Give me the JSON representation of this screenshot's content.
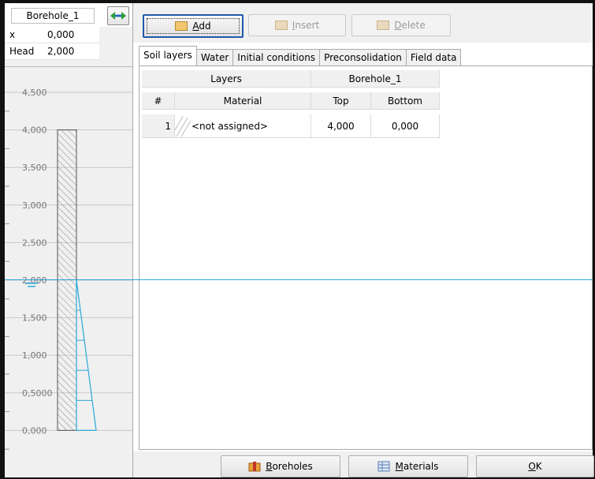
{
  "borehole": {
    "name": "Borehole_1",
    "props": [
      {
        "key": "x",
        "value": "0,000"
      },
      {
        "key": "Head",
        "value": "2,000"
      }
    ]
  },
  "depth_axis": {
    "labels": [
      "4,500",
      "4,000",
      "3,500",
      "3,000",
      "2,500",
      "2,000",
      "1,500",
      "1,000",
      "0,5000",
      "0,000"
    ],
    "head_level": 2.0,
    "layer_top": 4.0,
    "layer_bottom": 0.0
  },
  "toolbar": {
    "add_pre": "",
    "add_hot": "A",
    "add_post": "dd",
    "insert_pre": "",
    "insert_hot": "I",
    "insert_post": "nsert",
    "delete_pre": "",
    "delete_hot": "D",
    "delete_post": "elete"
  },
  "tabs": [
    "Soil layers",
    "Water",
    "Initial conditions",
    "Preconsolidation",
    "Field data"
  ],
  "table": {
    "group_layers": "Layers",
    "group_borehole": "Borehole_1",
    "col_num": "#",
    "col_material": "Material",
    "col_top": "Top",
    "col_bottom": "Bottom",
    "rows": [
      {
        "num": "1",
        "material": "<not assigned>",
        "top": "4,000",
        "bottom": "0,000"
      }
    ]
  },
  "bottom": {
    "boreholes_hot": "B",
    "boreholes_rest": "oreholes",
    "materials_hot": "M",
    "materials_rest": "aterials",
    "ok_hot": "O",
    "ok_rest": "K"
  },
  "colors": {
    "water": "#2aa8d8",
    "focus": "#1e5aa8"
  }
}
